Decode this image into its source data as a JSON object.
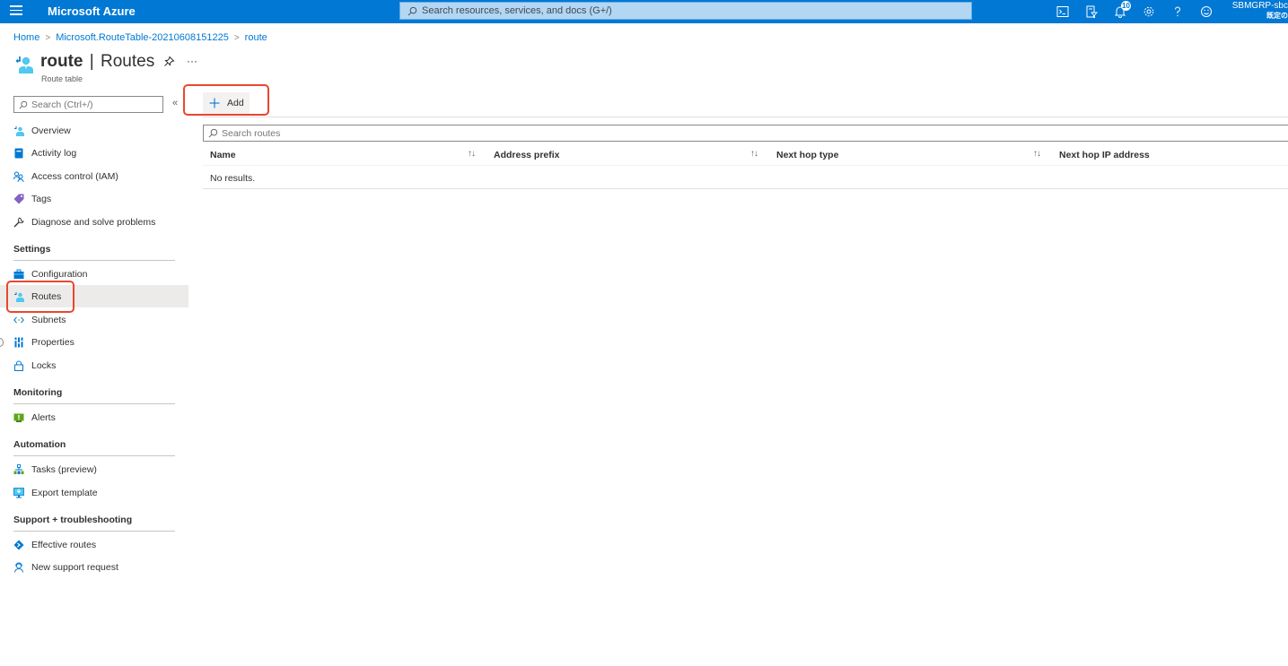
{
  "topbar": {
    "brand": "Microsoft Azure",
    "search_placeholder": "Search resources, services, and docs (G+/)",
    "notifications_count": "10",
    "icons": [
      "cloud-shell-icon",
      "directory-filter-icon",
      "notifications-icon",
      "settings-icon",
      "help-icon",
      "feedback-icon"
    ],
    "account_name": "SBMGRP-sbc",
    "account_directory": "既定の"
  },
  "breadcrumb": {
    "items": [
      "Home",
      "Microsoft.RouteTable-20210608151225",
      "route"
    ]
  },
  "header": {
    "resource_name": "route",
    "separator": "|",
    "blade_name": "Routes",
    "resource_type": "Route table",
    "more_label": "···"
  },
  "nav": {
    "search_placeholder": "Search (Ctrl+/)",
    "collapse_label": "«",
    "top_items": [
      {
        "label": "Overview",
        "icon": "route-table-icon"
      },
      {
        "label": "Activity log",
        "icon": "activity-log-icon"
      },
      {
        "label": "Access control (IAM)",
        "icon": "iam-icon"
      },
      {
        "label": "Tags",
        "icon": "tag-icon"
      },
      {
        "label": "Diagnose and solve problems",
        "icon": "wrench-icon"
      }
    ],
    "sections": [
      {
        "title": "Settings",
        "items": [
          {
            "label": "Configuration",
            "icon": "configuration-icon"
          },
          {
            "label": "Routes",
            "icon": "route-table-icon",
            "active": true
          },
          {
            "label": "Subnets",
            "icon": "subnet-icon"
          },
          {
            "label": "Properties",
            "icon": "properties-icon"
          },
          {
            "label": "Locks",
            "icon": "lock-icon"
          }
        ]
      },
      {
        "title": "Monitoring",
        "items": [
          {
            "label": "Alerts",
            "icon": "alert-icon"
          }
        ]
      },
      {
        "title": "Automation",
        "items": [
          {
            "label": "Tasks (preview)",
            "icon": "tasks-icon"
          },
          {
            "label": "Export template",
            "icon": "export-template-icon"
          }
        ]
      },
      {
        "title": "Support + troubleshooting",
        "items": [
          {
            "label": "Effective routes",
            "icon": "effective-routes-icon"
          },
          {
            "label": "New support request",
            "icon": "support-request-icon"
          }
        ]
      }
    ]
  },
  "toolbar": {
    "add_label": "Add"
  },
  "routes": {
    "search_placeholder": "Search routes",
    "columns": [
      "Name",
      "Address prefix",
      "Next hop type",
      "Next hop IP address"
    ],
    "sort_glyph": "↑↓",
    "empty_message": "No results.",
    "rows": []
  },
  "colors": {
    "accent": "#0078d4",
    "highlight": "#e8472e",
    "active_nav_bg": "#edebe9"
  }
}
